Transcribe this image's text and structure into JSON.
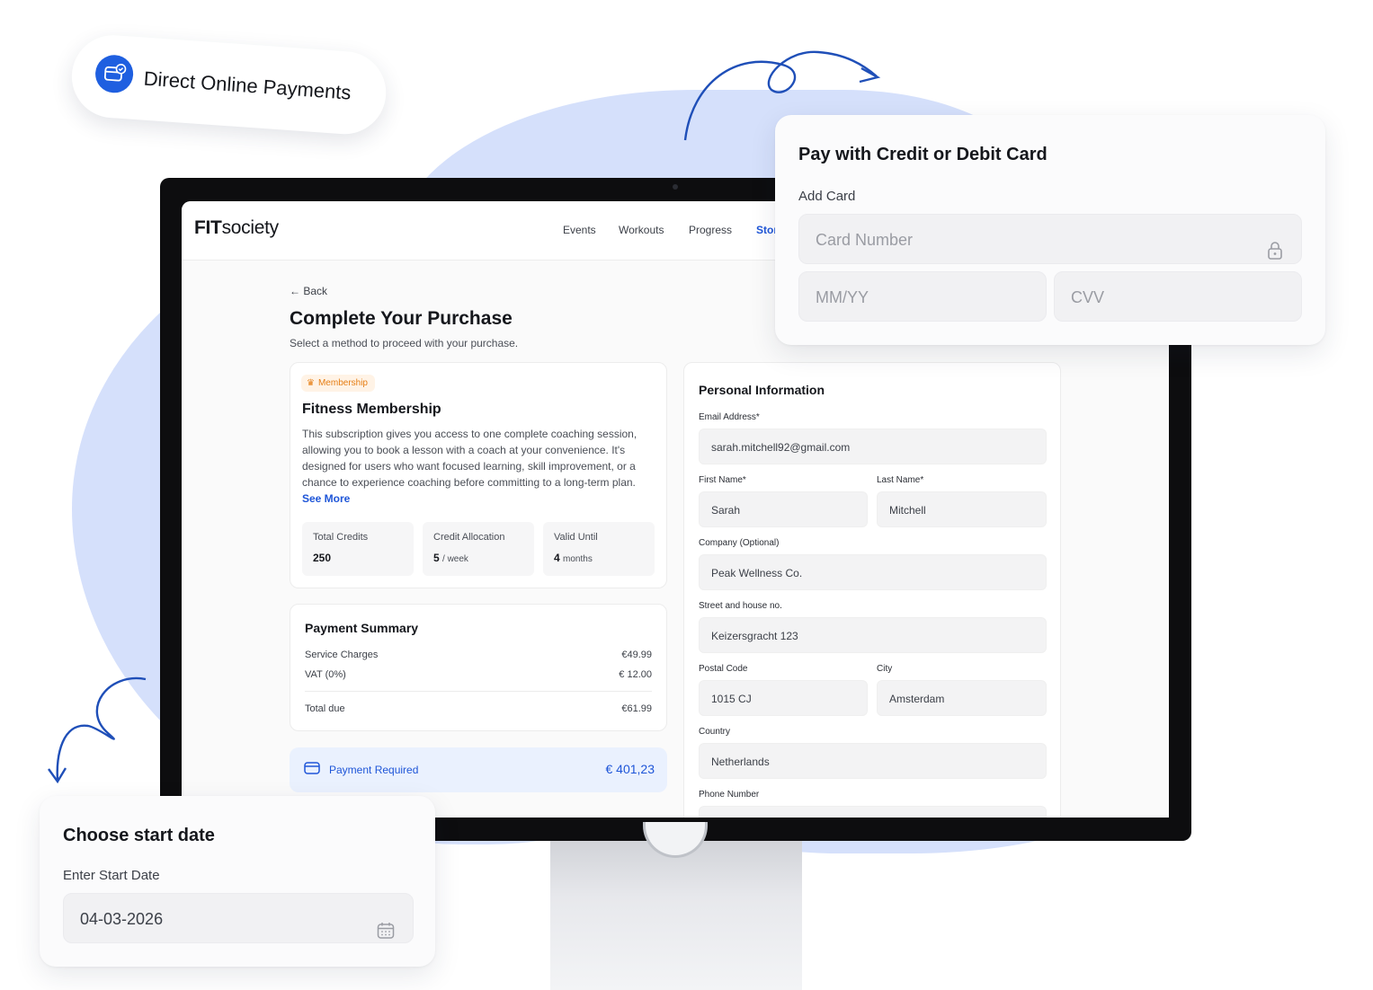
{
  "badge_pill": {
    "label": "Direct Online Payments",
    "icon": "card-check-icon"
  },
  "app": {
    "logo_bold": "FIT",
    "logo_rest": "society",
    "nav": [
      {
        "label": "Events"
      },
      {
        "label": "Workouts"
      },
      {
        "label": "Progress"
      },
      {
        "label": "Stor"
      }
    ],
    "back_label": "Back",
    "title": "Complete Your Purchase",
    "subtitle": "Select a method to proceed with your purchase."
  },
  "membership": {
    "badge": "Membership",
    "title": "Fitness Membership",
    "description": "This subscription gives you access to one complete coaching session, allowing you to book a lesson with a coach at your convenience. It's designed for users who want focused learning, skill improvement, or a chance to experience coaching before committing to a long-term plan.",
    "see_more": "See More",
    "stats": [
      {
        "label": "Total Credits",
        "value": "250",
        "unit": ""
      },
      {
        "label": "Credit Allocation",
        "value": "5",
        "unit": "/ week"
      },
      {
        "label": "Valid Until",
        "value": "4",
        "unit": "months"
      }
    ]
  },
  "payment_summary": {
    "title": "Payment Summary",
    "rows": [
      {
        "label": "Service Charges",
        "amount": "€49.99"
      },
      {
        "label": "VAT (0%)",
        "amount": "€ 12.00"
      }
    ],
    "total_label": "Total due",
    "total_amount": "€61.99"
  },
  "payment_required": {
    "label": "Payment Required",
    "amount": "€ 401,23"
  },
  "personal_info": {
    "title": "Personal Information",
    "email_label": "Email Address*",
    "email_value": "sarah.mitchell92@gmail.com",
    "first_name_label": "First Name*",
    "first_name_value": "Sarah",
    "last_name_label": "Last Name*",
    "last_name_value": "Mitchell",
    "company_label": "Company (Optional)",
    "company_value": "Peak Wellness Co.",
    "street_label": "Street and house no.",
    "street_value": "Keizersgracht 123",
    "postal_label": "Postal Code",
    "postal_value": "1015 CJ",
    "city_label": "City",
    "city_value": "Amsterdam",
    "country_label": "Country",
    "country_value": "Netherlands",
    "phone_label": "Phone Number"
  },
  "card_panel": {
    "title": "Pay with Credit or Debit Card",
    "add_card_label": "Add Card",
    "card_number_placeholder": "Card Number",
    "expiry_placeholder": "MM/YY",
    "cvv_placeholder": "CVV"
  },
  "start_date_panel": {
    "title": "Choose start date",
    "label": "Enter Start Date",
    "value": "04-03-2026"
  },
  "colors": {
    "accent": "#1f56d8",
    "badge_orange": "#e67e14",
    "blob": "#d5e0fb"
  }
}
